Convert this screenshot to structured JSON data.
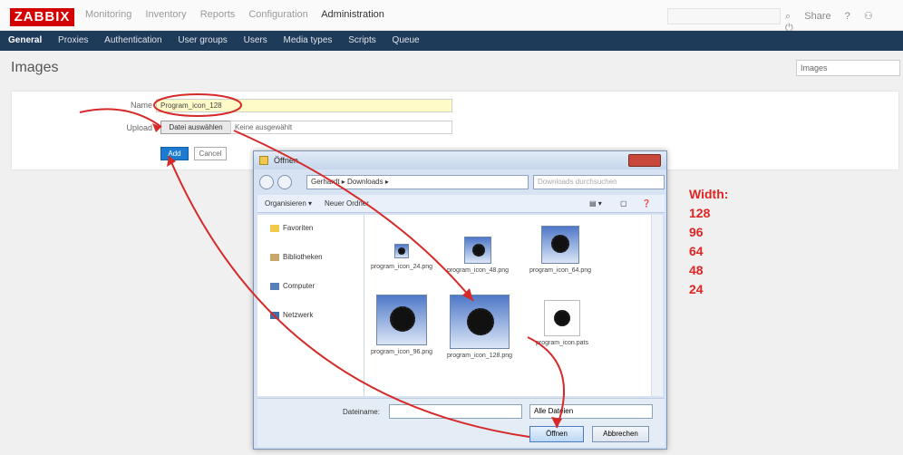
{
  "app": {
    "logo": "ZABBIX"
  },
  "top_menu": [
    "Monitoring",
    "Inventory",
    "Reports",
    "Configuration",
    "Administration"
  ],
  "top_right": {
    "share_label": "Share",
    "help_label": "?",
    "user_label": "⚇",
    "logout_label": "⏻"
  },
  "sub_menu": [
    "General",
    "Proxies",
    "Authentication",
    "User groups",
    "Users",
    "Media types",
    "Scripts",
    "Queue"
  ],
  "page": {
    "title": "Images",
    "type_select": "Images"
  },
  "form": {
    "name_label": "Name",
    "name_value": "Program_icon_128",
    "upload_label": "Upload",
    "upload_button": "Datei auswählen",
    "upload_value": "Keine ausgewählt",
    "add_button": "Add",
    "cancel_button": "Cancel"
  },
  "dialog": {
    "title": "Öffnen",
    "address": "Gerhardt ▸ Downloads ▸",
    "search_placeholder": "Downloads durchsuchen",
    "organize": "Organisieren ▾",
    "new_folder": "Neuer Ordner",
    "nav_items": [
      "Favoriten",
      "Bibliotheken",
      "Computer",
      "Netzwerk"
    ],
    "files": [
      {
        "name": "program_icon_24.png"
      },
      {
        "name": "program_icon_48.png"
      },
      {
        "name": "program_icon_64.png"
      },
      {
        "name": "program_icon_96.png"
      },
      {
        "name": "program_icon_128.png"
      },
      {
        "name": "program_icon.pats"
      }
    ],
    "filename_label": "Dateiname:",
    "filename_value": "",
    "filetype": "Alle Dateien",
    "open_button": "Öffnen",
    "cancel_button": "Abbrechen"
  },
  "annotation": {
    "heading": "Width:",
    "values": [
      "128",
      "96",
      "64",
      "48",
      "24"
    ],
    "color": "#e02424"
  }
}
